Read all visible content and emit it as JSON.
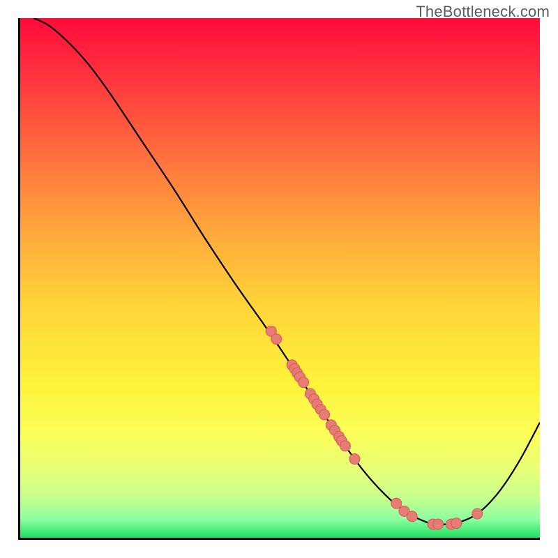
{
  "watermark": "TheBottleneck.com",
  "colors": {
    "curve_stroke": "#000000",
    "point_fill": "#e77c74",
    "point_stroke": "#d25f57",
    "gradient_top": "#ff0b3a",
    "gradient_bottom": "#17c85a"
  },
  "chart_data": {
    "type": "line",
    "title": "",
    "xlabel": "",
    "ylabel": "",
    "xlim": [
      0,
      100
    ],
    "ylim": [
      0,
      100
    ],
    "grid": false,
    "legend": false,
    "curve": [
      {
        "x": 3,
        "y": 100
      },
      {
        "x": 6,
        "y": 98.5
      },
      {
        "x": 10,
        "y": 95
      },
      {
        "x": 14,
        "y": 90.5
      },
      {
        "x": 18,
        "y": 85
      },
      {
        "x": 24,
        "y": 76
      },
      {
        "x": 30,
        "y": 67
      },
      {
        "x": 36,
        "y": 57.5
      },
      {
        "x": 42,
        "y": 48.5
      },
      {
        "x": 48,
        "y": 40
      },
      {
        "x": 54,
        "y": 31
      },
      {
        "x": 58,
        "y": 25
      },
      {
        "x": 62,
        "y": 19
      },
      {
        "x": 66,
        "y": 13.5
      },
      {
        "x": 70,
        "y": 9
      },
      {
        "x": 74,
        "y": 5.5
      },
      {
        "x": 78,
        "y": 3.5
      },
      {
        "x": 80,
        "y": 3
      },
      {
        "x": 82,
        "y": 3
      },
      {
        "x": 84,
        "y": 3.2
      },
      {
        "x": 88,
        "y": 5
      },
      {
        "x": 92,
        "y": 9
      },
      {
        "x": 96,
        "y": 15
      },
      {
        "x": 100,
        "y": 22.5
      }
    ],
    "points": [
      {
        "x": 48.5,
        "y": 40
      },
      {
        "x": 49.5,
        "y": 38.5
      },
      {
        "x": 52.5,
        "y": 33.5
      },
      {
        "x": 53.0,
        "y": 32.8
      },
      {
        "x": 53.5,
        "y": 32.0
      },
      {
        "x": 54.0,
        "y": 31.2
      },
      {
        "x": 54.7,
        "y": 30.2
      },
      {
        "x": 56.0,
        "y": 28
      },
      {
        "x": 56.7,
        "y": 27
      },
      {
        "x": 57.3,
        "y": 26
      },
      {
        "x": 58.0,
        "y": 25
      },
      {
        "x": 58.7,
        "y": 24
      },
      {
        "x": 60.0,
        "y": 22
      },
      {
        "x": 60.7,
        "y": 21
      },
      {
        "x": 61.5,
        "y": 19.8
      },
      {
        "x": 62.0,
        "y": 19
      },
      {
        "x": 62.7,
        "y": 18
      },
      {
        "x": 64.5,
        "y": 15.5
      },
      {
        "x": 72.5,
        "y": 7
      },
      {
        "x": 74.0,
        "y": 5.5
      },
      {
        "x": 75.5,
        "y": 4.5
      },
      {
        "x": 79.5,
        "y": 3.0
      },
      {
        "x": 80.5,
        "y": 3.0
      },
      {
        "x": 83.0,
        "y": 3.0
      },
      {
        "x": 84.0,
        "y": 3.2
      },
      {
        "x": 88.0,
        "y": 5.0
      }
    ]
  }
}
